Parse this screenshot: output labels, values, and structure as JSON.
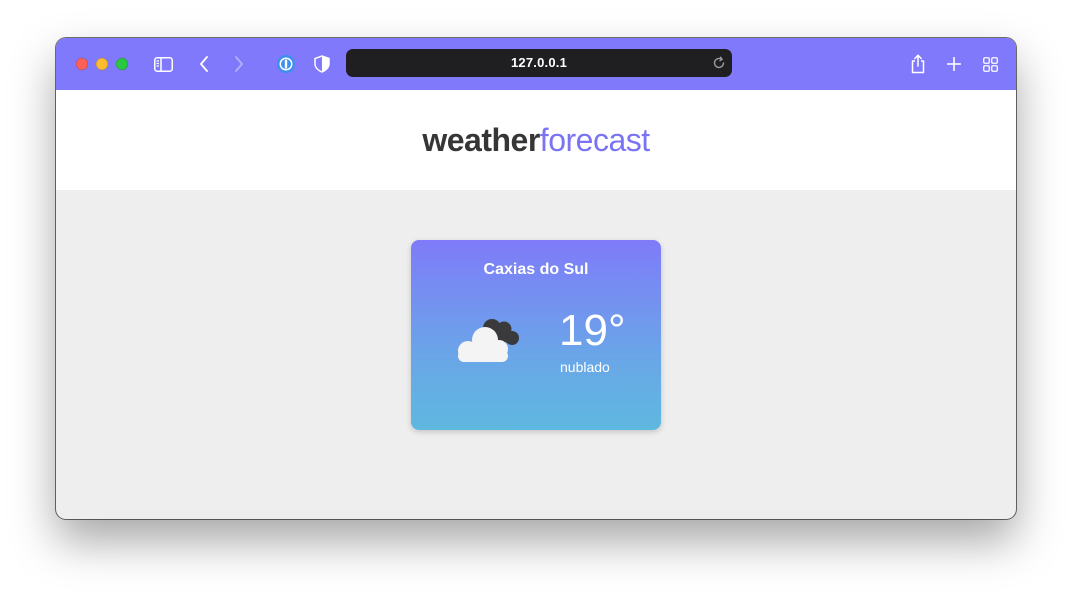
{
  "browser": {
    "address": "127.0.0.1",
    "toolbar_color": "#8079fb",
    "icons": [
      "sidebar-icon",
      "back-icon",
      "forward-icon",
      "password-manager-icon",
      "shield-icon",
      "reload-icon",
      "share-icon",
      "new-tab-icon",
      "tab-overview-icon"
    ]
  },
  "header": {
    "logo_part1": "weather",
    "logo_part2": "forecast",
    "logo_color_part2": "#7a74f5"
  },
  "weather_card": {
    "city": "Caxias do Sul",
    "temperature": "19°",
    "condition": "nublado",
    "icon": "cloudy-icon",
    "gradient_top": "#7f7bf9",
    "gradient_bottom": "#5eb8e0"
  }
}
